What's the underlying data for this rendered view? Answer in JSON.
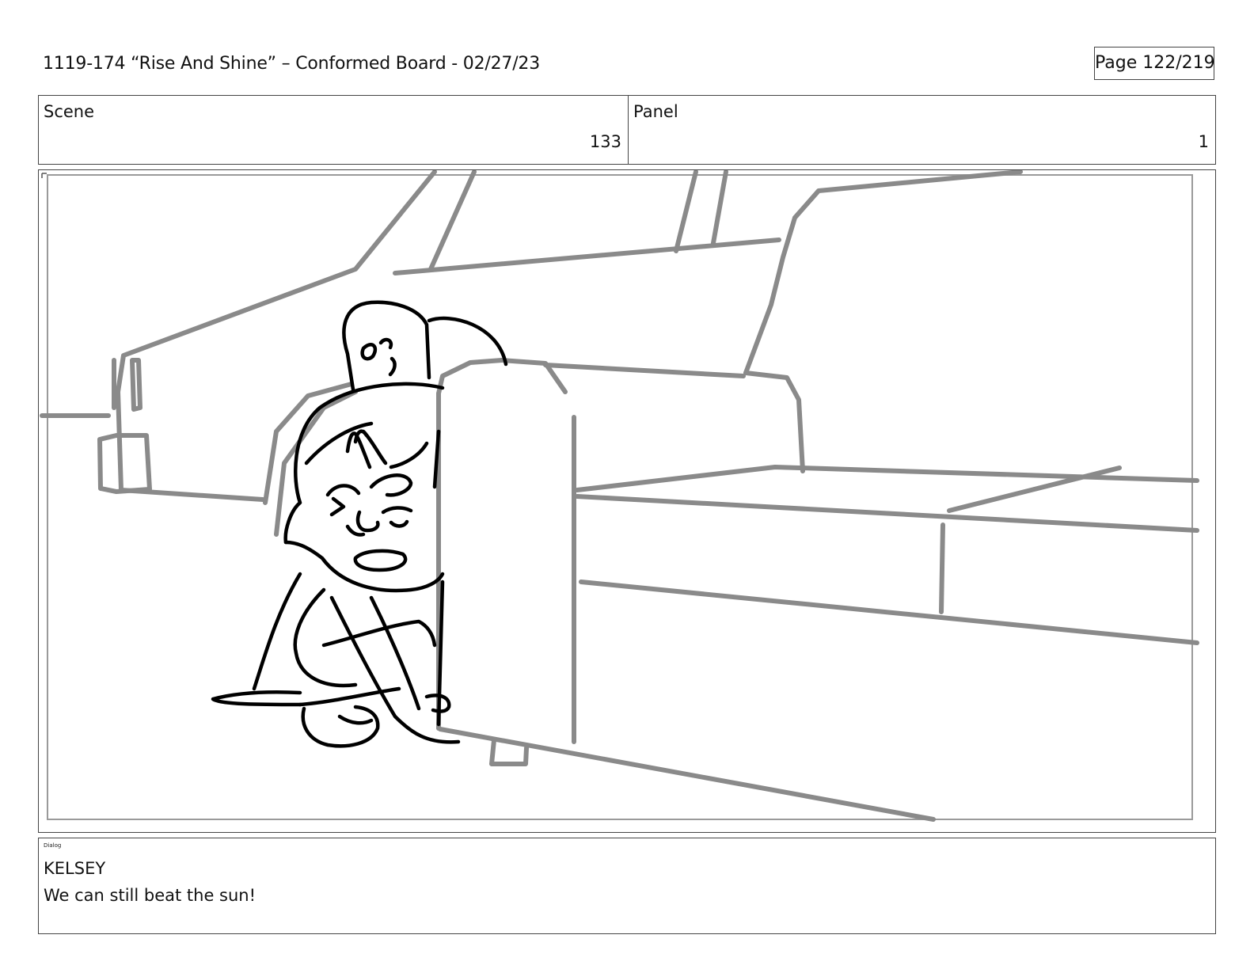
{
  "header": {
    "title": "1119-174 “Rise And Shine” – Conformed Board - 02/27/23",
    "page": "Page 122/219"
  },
  "info": {
    "scene_label": "Scene",
    "scene_value": "133",
    "panel_label": "Panel",
    "panel_value": "1"
  },
  "dialog": {
    "tag": "Dialog",
    "speaker": "KELSEY",
    "line": "We can still beat the sun!"
  },
  "colors": {
    "background_line": "#888888",
    "character_line": "#000000"
  }
}
